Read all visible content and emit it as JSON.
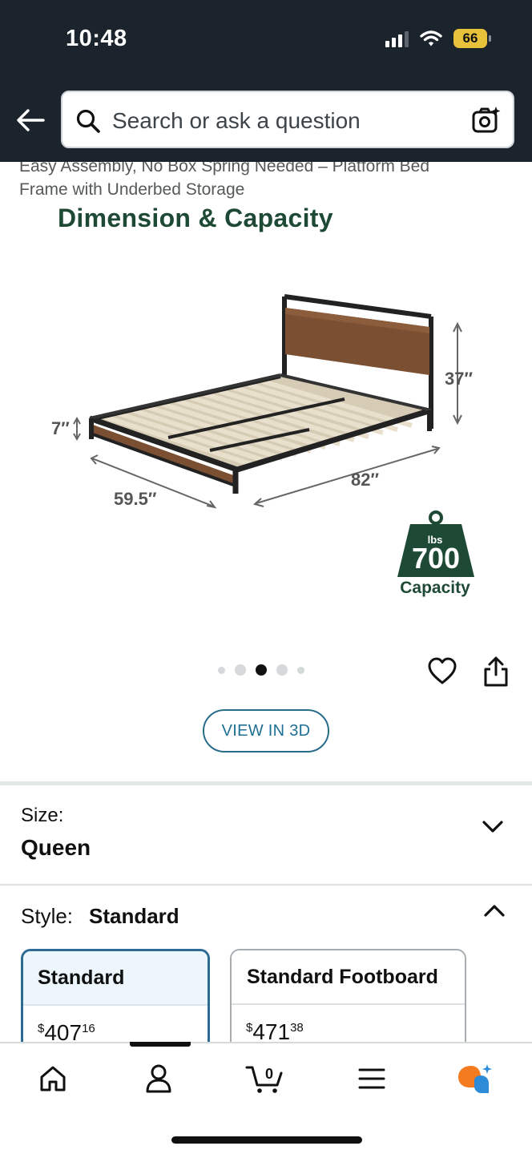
{
  "status_bar": {
    "time": "10:48",
    "battery": "66",
    "icons": [
      "signal-icon",
      "wifi-icon",
      "battery-icon"
    ]
  },
  "header": {
    "back_icon": "back-arrow-icon",
    "search_placeholder": "Search or ask a question",
    "camera_icon": "camera-search-icon"
  },
  "product": {
    "title_line1": "Easy Assembly, No Box Spring Needed – Platform Bed",
    "title_line2": "Frame with Underbed Storage",
    "image": {
      "heading": "Dimension & Capacity",
      "height_label": "37″",
      "clearance_label": "7″",
      "width_label": "59.5″",
      "length_label": "82″",
      "capacity_unit": "lbs",
      "capacity_value": "700",
      "capacity_label": "Capacity"
    },
    "carousel": {
      "count": 5,
      "active_index": 2
    },
    "wishlist_icon": "heart-icon",
    "share_icon": "share-icon",
    "view_3d_label": "VIEW IN 3D"
  },
  "size": {
    "label": "Size:",
    "value": "Queen"
  },
  "style": {
    "label": "Style:",
    "value": "Standard",
    "options": [
      {
        "name": "Standard",
        "currency": "$",
        "price_whole": "407",
        "price_cents": "16",
        "selected": true
      },
      {
        "name": "Standard Footboard",
        "currency": "$",
        "price_whole": "471",
        "price_cents": "38",
        "selected": false
      }
    ]
  },
  "bottom_nav": {
    "items": [
      "home-icon",
      "account-icon",
      "cart-icon",
      "menu-icon",
      "rufus-assistant-icon"
    ],
    "cart_count": "0"
  },
  "colors": {
    "header_bg": "#1b232c",
    "heading_green": "#1e4a35",
    "accent_blue": "#2d6a94",
    "battery_yellow": "#e8c23a",
    "rufus_orange": "#f47b20",
    "rufus_blue": "#2e8bd8"
  }
}
